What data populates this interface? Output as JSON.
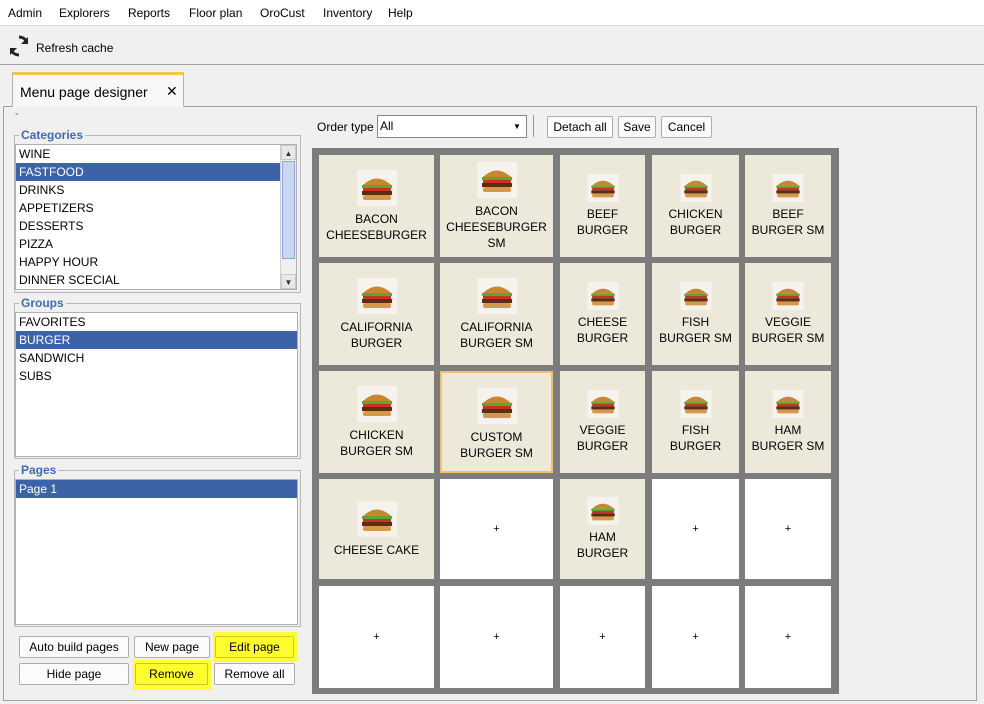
{
  "menu": [
    "Admin",
    "Explorers",
    "Reports",
    "Floor plan",
    "OroCust",
    "Inventory",
    "Help"
  ],
  "toolbar": {
    "refresh_label": "Refresh cache"
  },
  "tab": {
    "label": "Menu page designer",
    "close": "✕"
  },
  "top_dash": "-",
  "categories": {
    "legend": "Categories",
    "items": [
      "WINE",
      "FASTFOOD",
      "DRINKS",
      "APPETIZERS",
      "DESSERTS",
      "PIZZA",
      "HAPPY HOUR",
      "DINNER SCECIAL"
    ],
    "selected": "FASTFOOD"
  },
  "groups": {
    "legend": "Groups",
    "items": [
      "FAVORITES",
      "BURGER",
      "SANDWICH",
      "SUBS"
    ],
    "selected": "BURGER"
  },
  "pages": {
    "legend": "Pages",
    "items": [
      "Page 1"
    ],
    "selected": "Page 1"
  },
  "buttons": {
    "auto_build": "Auto build pages",
    "new_page": "New page",
    "edit_page": "Edit page",
    "hide_page": "Hide page",
    "remove": "Remove",
    "remove_all": "Remove all",
    "detach_all": "Detach all",
    "save": "Save",
    "cancel": "Cancel"
  },
  "order_type": {
    "label": "Order type",
    "value": "All"
  },
  "grid": {
    "rows": [
      [
        "BACON\nCHEESEBURGER",
        "BACON\nCHEESEBURGER\nSM",
        "BEEF\nBURGER",
        "CHICKEN\nBURGER",
        "BEEF\nBURGER SM"
      ],
      [
        "CALIFORNIA\nBURGER",
        "CALIFORNIA\nBURGER SM",
        "CHEESE\nBURGER",
        "FISH\nBURGER SM",
        "VEGGIE\nBURGER SM"
      ],
      [
        "CHICKEN\nBURGER SM",
        "CUSTOM\nBURGER SM",
        "VEGGIE\nBURGER",
        "FISH\nBURGER",
        "HAM\nBURGER SM"
      ],
      [
        "CHEESE CAKE",
        "+",
        "HAM\nBURGER",
        "+",
        "+"
      ],
      [
        "+",
        "+",
        "+",
        "+",
        "+"
      ]
    ],
    "selected_cell": "CUSTOM\nBURGER SM"
  },
  "colors": {
    "accent_tab": "#f6c64b",
    "selection": "#3c63a8",
    "legend": "#3f6bb3",
    "highlight": "#ffff2e",
    "cell_bg": "#ece9db",
    "grid_bg": "#7c7c7c"
  },
  "icons": {
    "refresh": "refresh-icon",
    "close": "close-icon",
    "dropdown": "chevron-down-icon"
  }
}
